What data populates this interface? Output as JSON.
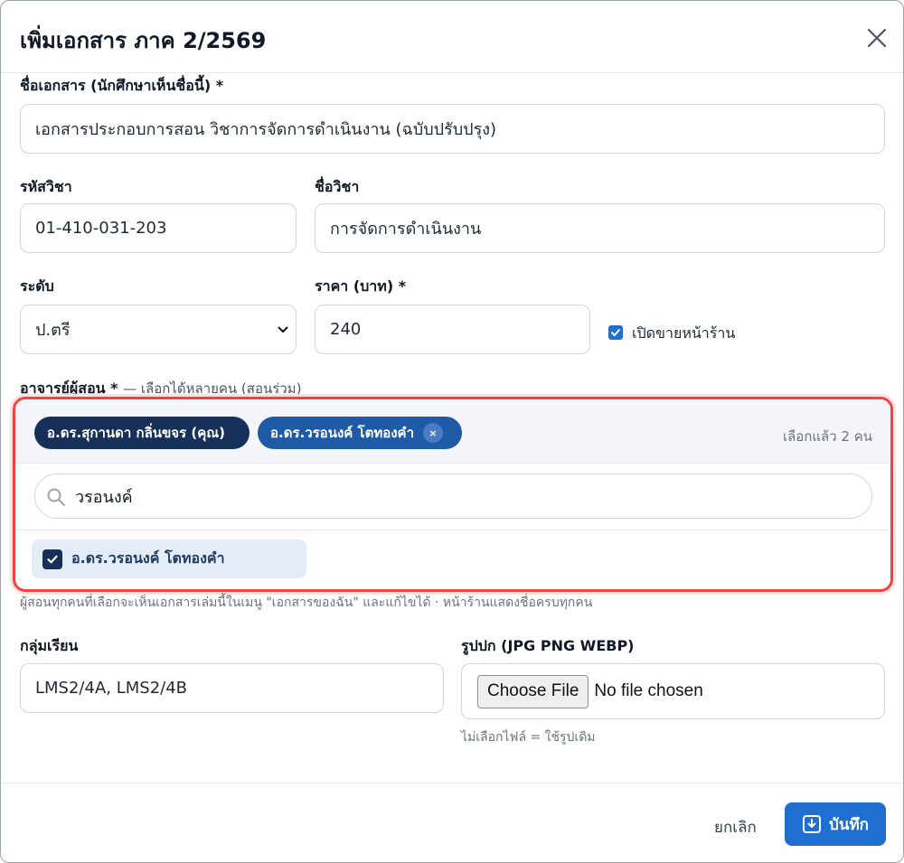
{
  "dialog": {
    "title": "เพิ่มเอกสาร ภาค 2/2569"
  },
  "form": {
    "doc_name": {
      "label": "ชื่อเอกสาร (นักศึกษาเห็นชื่อนี้) *",
      "value": "เอกสารประกอบการสอน วิชาการจัดการดำเนินงาน (ฉบับปรับปรุง)"
    },
    "course_code": {
      "label": "รหัสวิชา",
      "value": "01-410-031-203"
    },
    "course_name": {
      "label": "ชื่อวิชา",
      "value": "การจัดการดำเนินงาน"
    },
    "level": {
      "label": "ระดับ",
      "value": "ป.ตรี"
    },
    "price": {
      "label": "ราคา (บาท) *",
      "value": "240"
    },
    "storefront": {
      "label": "เปิดขายหน้าร้าน",
      "checked": true
    },
    "teachers": {
      "label": "อาจารย์ผู้สอน *",
      "hint": "— เลือกได้หลายคน (สอนร่วม)",
      "chips": [
        {
          "label": "อ.ดร.สุกานดา กลิ่นขจร (คุณ)"
        },
        {
          "label": "อ.ดร.วรอนงค์ โตทองคำ",
          "remove_icon": "×"
        }
      ],
      "selected_count": "เลือกแล้ว 2 คน",
      "search_value": "วรอนงค์",
      "results": [
        {
          "label": "อ.ดร.วรอนงค์ โตทองคำ",
          "checked": true
        }
      ],
      "note": "ผู้สอนทุกคนที่เลือกจะเห็นเอกสารเล่มนี้ในเมนู \"เอกสารของฉัน\" และแก้ไขได้ · หน้าร้านแสดงชื่อครบทุกคน"
    },
    "groups": {
      "label": "กลุ่มเรียน",
      "value": "LMS2/4A, LMS2/4B"
    },
    "cover": {
      "label": "รูปปก (JPG PNG WEBP)",
      "button_label": "Choose File",
      "status": "No file chosen",
      "note": "ไม่เลือกไฟล์ = ใช้รูปเดิม"
    }
  },
  "footer": {
    "cancel_label": "ยกเลิก",
    "save_label": "บันทึก"
  },
  "colors": {
    "primary": "#1f6fd0",
    "chip_dark": "#16305a",
    "highlight_border": "#ef4444"
  },
  "icons": {
    "close": "close-icon",
    "search": "search-icon",
    "save": "save-download-icon",
    "select": "chevron-down-icon"
  }
}
